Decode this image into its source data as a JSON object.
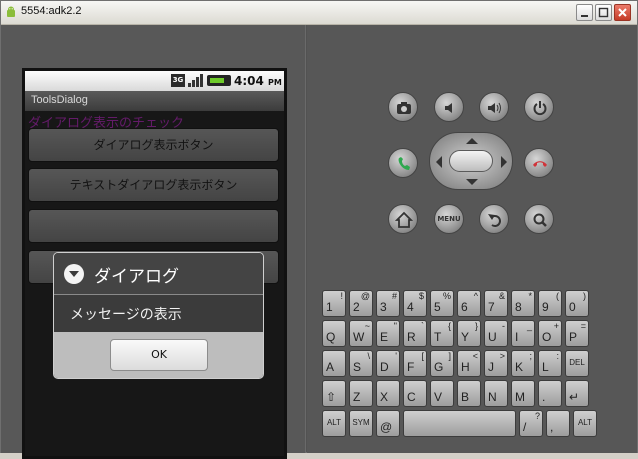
{
  "window": {
    "title": "5554:adk2.2",
    "controls": {
      "minimize": "minimize-icon",
      "maximize": "maximize-icon",
      "close": "close-icon"
    }
  },
  "status_bar": {
    "network": "3G",
    "time": "4:04",
    "ampm": "PM"
  },
  "app": {
    "title": "ToolsDialog",
    "heading": "ダイアログ表示のチェック",
    "heading_color": "#b632c0",
    "buttons": [
      {
        "label": "ダイアログ表示ボタン"
      },
      {
        "label": "テキストダイアログ表示ボタン"
      },
      {
        "label": ""
      },
      {
        "label": ""
      }
    ]
  },
  "dialog": {
    "title": "ダイアログ",
    "message": "メッセージの表示",
    "ok_label": "OK"
  },
  "controls": {
    "row1": [
      "camera-icon",
      "volume-down-icon",
      "volume-up-icon",
      "power-icon"
    ],
    "row2": [
      "call-icon",
      "dpad",
      "end-call-icon"
    ],
    "row3": [
      "home-icon",
      "menu-button",
      "back-icon",
      "search-icon"
    ],
    "menu_label": "MENU",
    "call_color": "#2fa84f",
    "end_call_color": "#d0343a"
  },
  "keyboard": {
    "rows": [
      [
        {
          "m": "1",
          "a": "!"
        },
        {
          "m": "2",
          "a": "@"
        },
        {
          "m": "3",
          "a": "#"
        },
        {
          "m": "4",
          "a": "$"
        },
        {
          "m": "5",
          "a": "%"
        },
        {
          "m": "6",
          "a": "^"
        },
        {
          "m": "7",
          "a": "&"
        },
        {
          "m": "8",
          "a": "*"
        },
        {
          "m": "9",
          "a": "("
        },
        {
          "m": "0",
          "a": ")"
        }
      ],
      [
        {
          "m": "Q",
          "a": ""
        },
        {
          "m": "W",
          "a": "~"
        },
        {
          "m": "E",
          "a": "\""
        },
        {
          "m": "R",
          "a": "`"
        },
        {
          "m": "T",
          "a": "{"
        },
        {
          "m": "Y",
          "a": "}"
        },
        {
          "m": "U",
          "a": "-"
        },
        {
          "m": "I",
          "a": "_"
        },
        {
          "m": "O",
          "a": "+"
        },
        {
          "m": "P",
          "a": "="
        }
      ],
      [
        {
          "m": "A",
          "a": ""
        },
        {
          "m": "S",
          "a": "\\"
        },
        {
          "m": "D",
          "a": "'"
        },
        {
          "m": "F",
          "a": "["
        },
        {
          "m": "G",
          "a": "]"
        },
        {
          "m": "H",
          "a": "<"
        },
        {
          "m": "J",
          "a": ">"
        },
        {
          "m": "K",
          "a": ";"
        },
        {
          "m": "L",
          "a": ":"
        },
        {
          "m": "DEL",
          "a": ""
        }
      ],
      [
        {
          "m": "⇧",
          "a": ""
        },
        {
          "m": "Z",
          "a": ""
        },
        {
          "m": "X",
          "a": ""
        },
        {
          "m": "C",
          "a": ""
        },
        {
          "m": "V",
          "a": ""
        },
        {
          "m": "B",
          "a": ""
        },
        {
          "m": "N",
          "a": ""
        },
        {
          "m": "M",
          "a": ""
        },
        {
          "m": ".",
          "a": ""
        },
        {
          "m": "↵",
          "a": ""
        }
      ],
      [
        {
          "m": "ALT",
          "a": ""
        },
        {
          "m": "SYM",
          "a": ""
        },
        {
          "m": "@",
          "a": ""
        },
        {
          "m": "",
          "a": ""
        },
        {
          "m": "/",
          "a": "?"
        },
        {
          "m": ",",
          "a": ""
        },
        {
          "m": "ALT",
          "a": ""
        }
      ]
    ]
  }
}
